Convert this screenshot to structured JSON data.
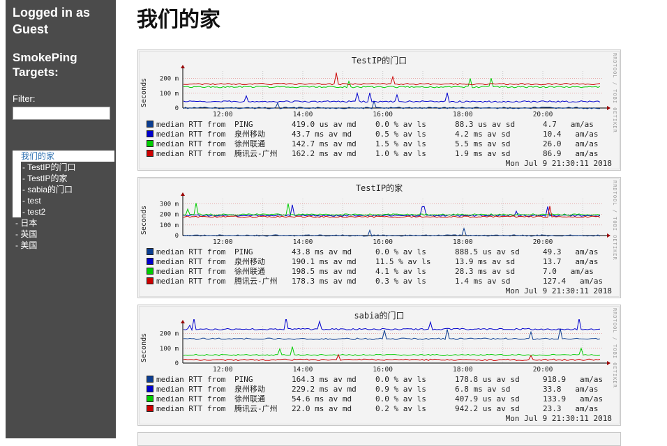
{
  "sidebar": {
    "login_title": "Logged in as Guest",
    "targets_title": "SmokePing Targets:",
    "filter_label": "Filter:",
    "filter_value": "",
    "nav": [
      {
        "label": "我们的家",
        "kind": "active"
      },
      {
        "label": "- TestIP的门口",
        "kind": "child"
      },
      {
        "label": "- TestIP的家",
        "kind": "child"
      },
      {
        "label": "- sabia的门口",
        "kind": "child"
      },
      {
        "label": "- test",
        "kind": "child"
      },
      {
        "label": "- test2",
        "kind": "child"
      },
      {
        "label": "- 日本",
        "kind": "top"
      },
      {
        "label": "- 英国",
        "kind": "top"
      },
      {
        "label": "- 美国",
        "kind": "top"
      }
    ]
  },
  "page_title": "我们的家",
  "graph_common": {
    "ylabel": "Seconds",
    "side_text": "RRDTOOL / TOBI OETIKER",
    "x_ticks": [
      "12:00",
      "14:00",
      "16:00",
      "18:00",
      "20:00"
    ],
    "legend_prefix": "median RTT from",
    "timestamp": "Mon Jul  9 21:30:11 2018"
  },
  "colors": {
    "ping": "#0b3d91",
    "quanzhou": "#0000cc",
    "xuzhou": "#00cc00",
    "tencent": "#cc0000",
    "axis": "#000000",
    "grid": "#cccccc",
    "arrow": "#990000"
  },
  "graphs": [
    {
      "title": "TestIP的门口",
      "y_ticks": [
        "200 m",
        "100 m",
        "0"
      ],
      "chart_data": {
        "type": "line",
        "x": [
          "11:00",
          "21:30"
        ],
        "ylim": [
          0,
          0.25
        ],
        "series": [
          {
            "name": "PING",
            "values": [
              0.0004,
              0.0004
            ]
          },
          {
            "name": "泉州移动",
            "values": [
              0.0437,
              0.0437
            ]
          },
          {
            "name": "徐州联通",
            "values": [
              0.1427,
              0.1427
            ]
          },
          {
            "name": "腾讯云-广州",
            "values": [
              0.1622,
              0.1622
            ]
          }
        ]
      },
      "legend": [
        {
          "color": "#0b3d91",
          "name": "PING",
          "rtt": "419.0 us av md",
          "loss": "0.0 % av ls",
          "sd": "88.3 us av sd",
          "amas": "4.7   am/as"
        },
        {
          "color": "#0000cc",
          "name": "泉州移动",
          "rtt": "43.7 ms av md",
          "loss": "0.5 % av ls",
          "sd": "4.2 ms av sd",
          "amas": "10.4   am/as"
        },
        {
          "color": "#00cc00",
          "name": "徐州联通",
          "rtt": "142.7 ms av md",
          "loss": "1.5 % av ls",
          "sd": "5.5 ms av sd",
          "amas": "26.0   am/as"
        },
        {
          "color": "#cc0000",
          "name": "腾讯云-广州",
          "rtt": "162.2 ms av md",
          "loss": "1.0 % av ls",
          "sd": "1.9 ms av sd",
          "amas": "86.9   am/as"
        }
      ]
    },
    {
      "title": "TestIP的家",
      "y_ticks": [
        "300 m",
        "200 m",
        "100 m",
        "0"
      ],
      "chart_data": {
        "type": "line",
        "x": [
          "11:00",
          "21:30"
        ],
        "ylim": [
          0,
          0.35
        ],
        "series": [
          {
            "name": "PING",
            "values": [
              4.38e-05,
              4.38e-05
            ]
          },
          {
            "name": "泉州移动",
            "values": [
              0.1901,
              0.1901
            ]
          },
          {
            "name": "徐州联通",
            "values": [
              0.1985,
              0.1985
            ]
          },
          {
            "name": "腾讯云-广州",
            "values": [
              0.1783,
              0.1783
            ]
          }
        ]
      },
      "legend": [
        {
          "color": "#0b3d91",
          "name": "PING",
          "rtt": "43.8 ms av md",
          "loss": "0.0 % av ls",
          "sd": "888.5 us av sd",
          "amas": "49.3   am/as"
        },
        {
          "color": "#0000cc",
          "name": "泉州移动",
          "rtt": "190.1 ms av md",
          "loss": "11.5 % av ls",
          "sd": "13.9 ms av sd",
          "amas": "13.7   am/as"
        },
        {
          "color": "#00cc00",
          "name": "徐州联通",
          "rtt": "198.5 ms av md",
          "loss": "4.1 % av ls",
          "sd": "28.3 ms av sd",
          "amas": "7.0   am/as"
        },
        {
          "color": "#cc0000",
          "name": "腾讯云-广州",
          "rtt": "178.3 ms av md",
          "loss": "0.3 % av ls",
          "sd": "1.4 ms av sd",
          "amas": "127.4   am/as"
        }
      ]
    },
    {
      "title": "sabia的门口",
      "y_ticks": [
        "200 m",
        "100 m",
        "0"
      ],
      "chart_data": {
        "type": "line",
        "x": [
          "11:00",
          "21:30"
        ],
        "ylim": [
          0,
          0.25
        ],
        "series": [
          {
            "name": "PING",
            "values": [
              0.1643,
              0.1643
            ]
          },
          {
            "name": "泉州移动",
            "values": [
              0.2292,
              0.2292
            ]
          },
          {
            "name": "徐州联通",
            "values": [
              0.0546,
              0.0546
            ]
          },
          {
            "name": "腾讯云-广州",
            "values": [
              0.022,
              0.022
            ]
          }
        ]
      },
      "legend": [
        {
          "color": "#0b3d91",
          "name": "PING",
          "rtt": "164.3 ms av md",
          "loss": "0.0 % av ls",
          "sd": "178.8 us av sd",
          "amas": "918.9   am/as"
        },
        {
          "color": "#0000cc",
          "name": "泉州移动",
          "rtt": "229.2 ms av md",
          "loss": "0.9 % av ls",
          "sd": "6.8 ms av sd",
          "amas": "33.8   am/as"
        },
        {
          "color": "#00cc00",
          "name": "徐州联通",
          "rtt": "54.6 ms av md",
          "loss": "0.0 % av ls",
          "sd": "407.9 us av sd",
          "amas": "133.9   am/as"
        },
        {
          "color": "#cc0000",
          "name": "腾讯云-广州",
          "rtt": "22.0 ms av md",
          "loss": "0.2 % av ls",
          "sd": "942.2 us av sd",
          "amas": "23.3   am/as"
        }
      ]
    }
  ]
}
